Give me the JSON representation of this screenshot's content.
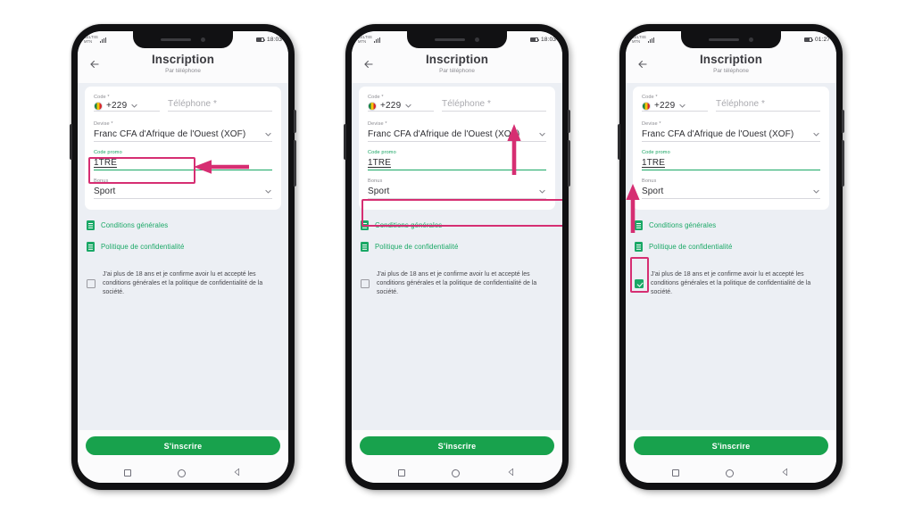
{
  "page": {
    "background": "#ffffff",
    "accent_green": "#1aa866",
    "accent_pink": "#d62e72",
    "button_green": "#18a24d"
  },
  "app": {
    "title": "Inscription",
    "subtitle": "Par téléphone",
    "back_icon": "back-arrow-icon"
  },
  "status_bar": {
    "carrier_line1": "CELTIIS",
    "carrier_line2": "MTN",
    "times": [
      "18:03",
      "18:03",
      "01:27"
    ]
  },
  "form": {
    "code_label": "Code *",
    "code_value": "+229",
    "phone_placeholder": "Téléphone *",
    "devise_label": "Devise *",
    "devise_value": "Franc CFA d'Afrique de l'Ouest (XOF)",
    "promo_label": "Code promo",
    "promo_value": "1TRE",
    "bonus_label": "Bonus",
    "bonus_value": "Sport"
  },
  "links": {
    "terms": "Conditions générales",
    "privacy": "Politique de confidentialité"
  },
  "consent": {
    "text": "J'ai plus de 18 ans et je confirme avoir lu et accepté les conditions générales et la politique de confidentialité de la société."
  },
  "submit": {
    "label": "S'inscrire"
  },
  "nav": {
    "recent": "square-recents-icon",
    "home": "circle-home-icon",
    "back": "triangle-back-icon"
  },
  "annotations": {
    "phone1": {
      "highlight": "code-promo-field",
      "arrow": "arrow-left"
    },
    "phone2": {
      "highlight": "bonus-select",
      "arrow": "arrow-up"
    },
    "phone3": {
      "highlight": "consent-checkbox",
      "arrow": "arrow-up"
    }
  }
}
